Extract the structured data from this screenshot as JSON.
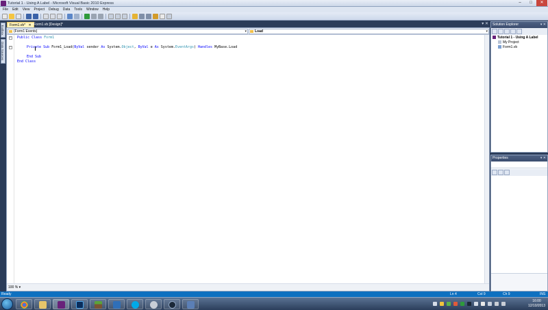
{
  "window": {
    "title": "Tutorial 1 - Using A Label - Microsoft Visual Basic 2010 Express",
    "controls": [
      "–",
      "□",
      "✕"
    ]
  },
  "menu": [
    "File",
    "Edit",
    "View",
    "Project",
    "Debug",
    "Data",
    "Tools",
    "Window",
    "Help"
  ],
  "side_tabs": [
    "Toolbox",
    "Data Sources"
  ],
  "tabs": [
    {
      "label": "Form1.vb*",
      "close": "✕",
      "active": true
    },
    {
      "label": "Form1.vb [Design]*",
      "active": false
    }
  ],
  "editor": {
    "object_combo": "(Form1 Events)",
    "event_combo": "Load",
    "zoom": "100 %",
    "code": {
      "line1": {
        "kw": "Public Class",
        "name": "Form1"
      },
      "line3": {
        "kw1": "Private Sub",
        "name": "Form1_Load(",
        "kw2": "ByVal",
        "p1": "sender",
        "kw3": "As",
        "t1a": "System.",
        "t1b": "Object",
        "sep": ",",
        "kw4": "ByVal",
        "p2": "e",
        "kw5": "As",
        "t2a": "System.",
        "t2b": "EventArgs",
        "kw6": ")",
        "kw7": "Handles",
        "h": "MyBase.Load"
      },
      "line5": {
        "kw": "End Sub"
      },
      "line6": {
        "kw": "End Class"
      }
    }
  },
  "solution_explorer": {
    "title": "Solution Explorer",
    "items": [
      "Tutorial 1 - Using A Label",
      "My Project",
      "Form1.vb"
    ]
  },
  "properties": {
    "title": "Properties"
  },
  "status": {
    "ready": "Ready",
    "ln": "Ln 4",
    "col": "Col 9",
    "ch": "Ch 9",
    "ins": "INS"
  },
  "clock": {
    "time": "16:00",
    "date": "12/10/2013"
  },
  "colors": {
    "keyword": "#0000ff",
    "type": "#2b91af",
    "status_bar": "#0e70c0",
    "ide_frame": "#2b3c59"
  }
}
